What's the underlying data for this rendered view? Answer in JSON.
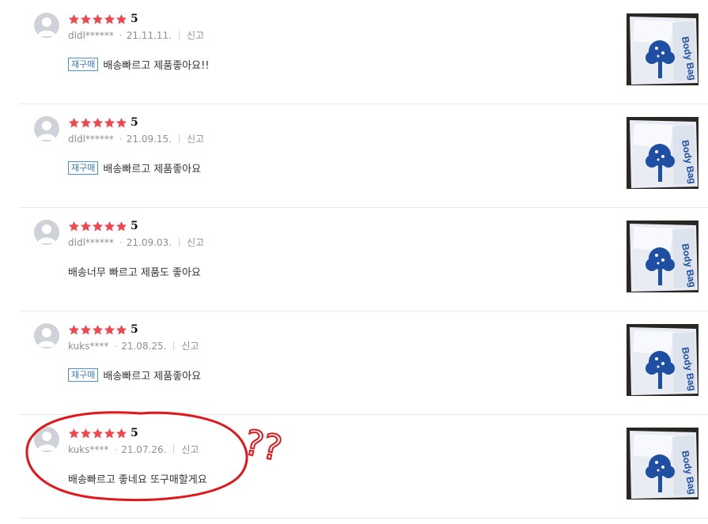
{
  "reviews": [
    {
      "rating": 5,
      "score_text": "5",
      "user": "dldl******",
      "date": "21.11.11.",
      "report_label": "신고",
      "badge": "재구매",
      "text": "배송빠르고 제품좋아요!!",
      "photo_text": "Body Bag"
    },
    {
      "rating": 5,
      "score_text": "5",
      "user": "dldl******",
      "date": "21.09.15.",
      "report_label": "신고",
      "badge": "재구매",
      "text": "배송빠르고 제품좋아요",
      "photo_text": "Body Bag"
    },
    {
      "rating": 5,
      "score_text": "5",
      "user": "dldl******",
      "date": "21.09.03.",
      "report_label": "신고",
      "badge": "",
      "text": "배송너무 빠르고 제품도 좋아요",
      "photo_text": "Body Bag"
    },
    {
      "rating": 5,
      "score_text": "5",
      "user": "kuks****",
      "date": "21.08.25.",
      "report_label": "신고",
      "badge": "재구매",
      "text": "배송빠르고 제품좋아요",
      "photo_text": "Body Bag"
    },
    {
      "rating": 5,
      "score_text": "5",
      "user": "kuks****",
      "date": "21.07.26.",
      "report_label": "신고",
      "badge": "",
      "text": "배송빠르고 좋네요 또구매할게요",
      "photo_text": "Body Bag"
    }
  ],
  "annotation": {
    "marks": "??",
    "color": "#e3161b"
  },
  "colors": {
    "star": "#f0464f",
    "badge_border": "#4d8fd6",
    "divider": "#e7e7e7",
    "meta_text": "#8f8f8f"
  }
}
